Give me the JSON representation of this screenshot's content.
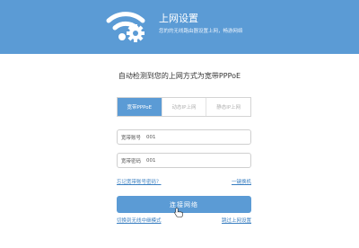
{
  "header": {
    "title": "上网设置",
    "subtitle": "您的的无线路由器设置上网，畅游网络"
  },
  "detect_text": "自动检测到您的上网方式为宽带PPPoE",
  "tabs": [
    {
      "label": "宽带PPPoE",
      "active": true
    },
    {
      "label": "动态IP上网",
      "active": false
    },
    {
      "label": "静态IP上网",
      "active": false
    }
  ],
  "form": {
    "account_label": "宽带账号",
    "account_value": "001",
    "password_label": "宽带密码",
    "password_value": "001"
  },
  "links": {
    "forgot": "忘记宽带账号密码？",
    "one_click": "一键换机",
    "wireless_relay": "切换到无线中继模式",
    "skip": "跳过上网设置"
  },
  "primary_button": "连接网络",
  "colors": {
    "brand": "#5b9bd5",
    "link": "#3a7fc1"
  }
}
